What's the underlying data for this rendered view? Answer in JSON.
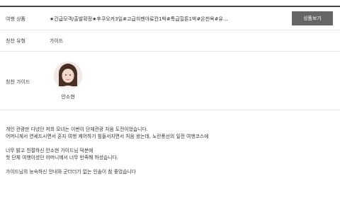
{
  "trip_row": {
    "label": "여행 상품",
    "value": "★긴급모객/출발확정★후쿠오카3일#고급히젠야료칸1박#특급힐튼1박#온천욕#유...",
    "button_label": "상품보기"
  },
  "praise_type_row": {
    "label": "칭찬 유형",
    "value": "가이드"
  },
  "praise_guide_row": {
    "label": "칭찬 가이드",
    "guide_name": "안소현"
  },
  "review": {
    "lines": [
      "개인 관광만 다녔던 저희 모녀는 이번이 단체관광 처음 도전이었습니다.",
      "어머니께서 연세드시면서 혼자 여행 케어하기 힘들서지면서 처음 왔는데, 노란풍선의 일전 여행코스에",
      "",
      "너무 밝고 친절하신 안소현 가이드님 덕분에",
      "첫 단체 여행이셨던 어머니께서 너무 만족해 하셨습니다.",
      "",
      "가이드님의 능숙하신 안내와 군더더기 없는 인솔이 참 좋았습니다"
    ]
  }
}
